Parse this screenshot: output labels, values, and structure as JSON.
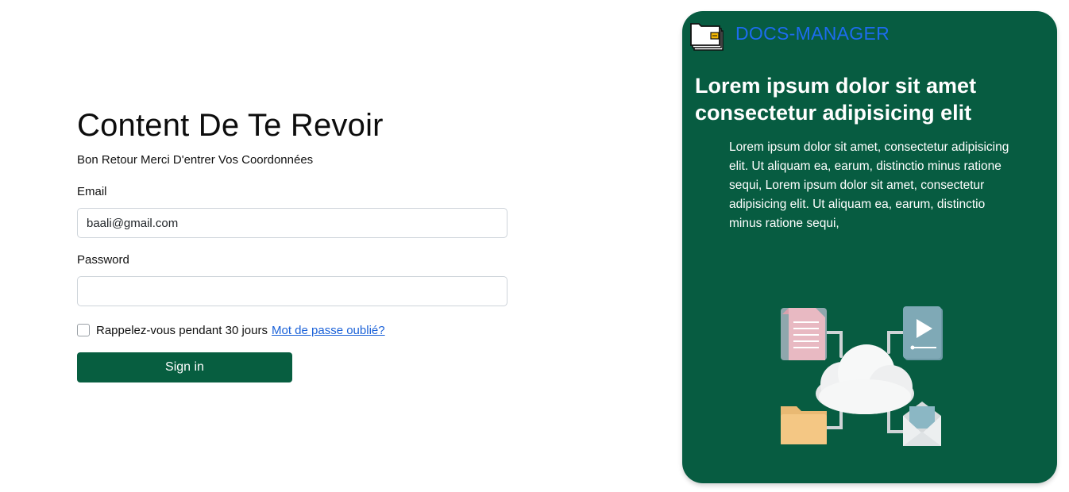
{
  "login": {
    "title": "Content De Te Revoir",
    "subtitle": "Bon Retour Merci D'entrer Vos Coordonnées",
    "email_label": "Email",
    "email_value": "baali@gmail.com",
    "password_label": "Password",
    "password_value": "",
    "remember_label": "Rappelez-vous pendant 30 jours",
    "remember_checked": false,
    "forgot_link": "Mot de passe oublié?",
    "signin_label": "Sign in"
  },
  "panel": {
    "brand": "DOCS-MANAGER",
    "heading": "Lorem ipsum dolor sit amet consectetur adipisicing elit",
    "body": "Lorem ipsum dolor sit amet, consectetur adipisicing elit. Ut aliquam ea, earum, distinctio minus ratione sequi, Lorem ipsum dolor sit amet, consectetur adipisicing elit. Ut aliquam ea, earum, distinctio minus ratione sequi,",
    "brand_icon": "folder-stack-icon",
    "illustration": "cloud-documents-illustration"
  },
  "colors": {
    "primary_green": "#075e40",
    "brand_blue": "#1d6cf0",
    "link_blue": "#1a61d8"
  }
}
